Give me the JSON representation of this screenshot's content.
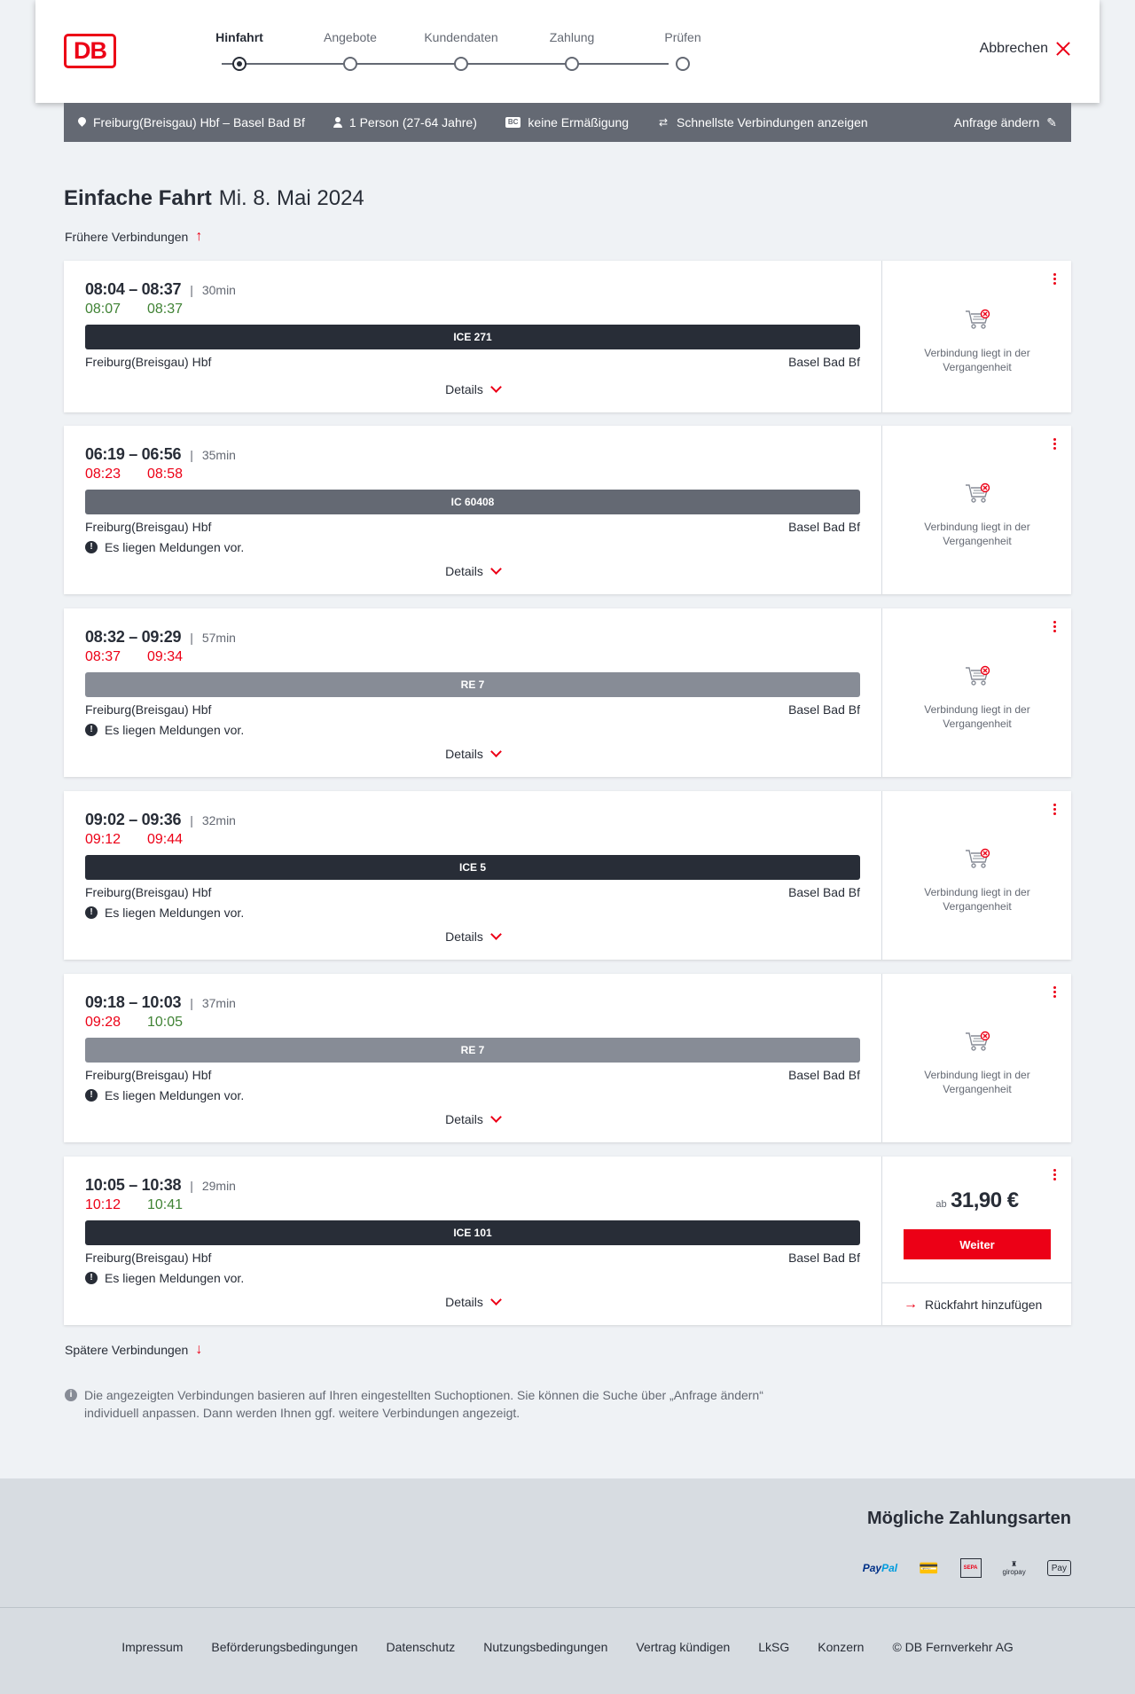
{
  "header": {
    "logo_text": "DB",
    "steps": [
      {
        "label": "Hinfahrt",
        "active": true
      },
      {
        "label": "Angebote",
        "active": false
      },
      {
        "label": "Kundendaten",
        "active": false
      },
      {
        "label": "Zahlung",
        "active": false
      },
      {
        "label": "Prüfen",
        "active": false
      }
    ],
    "cancel_label": "Abbrechen"
  },
  "search": {
    "route": "Freiburg(Breisgau) Hbf – Basel Bad Bf",
    "travellers": "1 Person (27-64 Jahre)",
    "discount_badge": "BC",
    "discount": "keine Ermäßigung",
    "fastest": "Schnellste Verbindungen anzeigen",
    "edit_label": "Anfrage ändern"
  },
  "main": {
    "title": "Einfache Fahrt",
    "date": "Mi. 8. Mai 2024",
    "earlier_label": "Frühere Verbindungen",
    "later_label": "Spätere Verbindungen",
    "details_label": "Details",
    "past_label_line1": "Verbindung liegt in der",
    "past_label_line2": "Vergangenheit",
    "notice_text": "Es liegen Meldungen vor.",
    "info_text": "Die angezeigten Verbindungen basieren auf Ihren eingestellten Suchoptionen. Sie können die Suche über „Anfrage ändern“ individuell anpassen. Dann werden Ihnen ggf. weitere Verbindungen angezeigt."
  },
  "connections": [
    {
      "times": "08:04 – 08:37",
      "duration": "30min",
      "rt_dep": "08:07",
      "rt_dep_color": "green",
      "rt_arr": "08:37",
      "rt_arr_color": "green",
      "train": "ICE 271",
      "train_color": "#282d37",
      "from": "Freiburg(Breisgau) Hbf",
      "to": "Basel Bad Bf",
      "notice": false,
      "past": true
    },
    {
      "times": "06:19 – 06:56",
      "duration": "35min",
      "rt_dep": "08:23",
      "rt_dep_color": "red",
      "rt_arr": "08:58",
      "rt_arr_color": "red",
      "train": "IC 60408",
      "train_color": "#646973",
      "from": "Freiburg(Breisgau) Hbf",
      "to": "Basel Bad Bf",
      "notice": true,
      "past": true
    },
    {
      "times": "08:32 – 09:29",
      "duration": "57min",
      "rt_dep": "08:37",
      "rt_dep_color": "red",
      "rt_arr": "09:34",
      "rt_arr_color": "red",
      "train": "RE 7",
      "train_color": "#878c96",
      "from": "Freiburg(Breisgau) Hbf",
      "to": "Basel Bad Bf",
      "notice": true,
      "past": true
    },
    {
      "times": "09:02 – 09:36",
      "duration": "32min",
      "rt_dep": "09:12",
      "rt_dep_color": "red",
      "rt_arr": "09:44",
      "rt_arr_color": "red",
      "train": "ICE 5",
      "train_color": "#282d37",
      "from": "Freiburg(Breisgau) Hbf",
      "to": "Basel Bad Bf",
      "notice": true,
      "past": true
    },
    {
      "times": "09:18 – 10:03",
      "duration": "37min",
      "rt_dep": "09:28",
      "rt_dep_color": "red",
      "rt_arr": "10:05",
      "rt_arr_color": "green",
      "train": "RE 7",
      "train_color": "#878c96",
      "from": "Freiburg(Breisgau) Hbf",
      "to": "Basel Bad Bf",
      "notice": true,
      "past": true
    },
    {
      "times": "10:05 – 10:38",
      "duration": "29min",
      "rt_dep": "10:12",
      "rt_dep_color": "red",
      "rt_arr": "10:41",
      "rt_arr_color": "green",
      "train": "ICE 101",
      "train_color": "#282d37",
      "from": "Freiburg(Breisgau) Hbf",
      "to": "Basel Bad Bf",
      "notice": true,
      "past": false,
      "price_prefix": "ab",
      "price": "31,90 €",
      "button": "Weiter",
      "return_label": "Rückfahrt hinzufügen"
    }
  ],
  "footer": {
    "payment_title": "Mögliche Zahlungsarten",
    "payment_icons": [
      "paypal-icon",
      "credit-card-icon",
      "sepa-icon",
      "giropay-icon",
      "apple-pay-icon"
    ],
    "paypal_a": "Pay",
    "paypal_b": "Pal",
    "sepa_text": "SEPA",
    "giropay_text": "giropay",
    "applepay_text": "Pay",
    "links": [
      "Impressum",
      "Beförderungsbedingungen",
      "Datenschutz",
      "Nutzungsbedingungen",
      "Vertrag kündigen",
      "LkSG",
      "Konzern",
      "© DB Fernverkehr AG"
    ]
  },
  "colors": {
    "brand_red": "#ec0016",
    "dark": "#282d37",
    "on_time_green": "#408335",
    "grey": "#646973"
  }
}
